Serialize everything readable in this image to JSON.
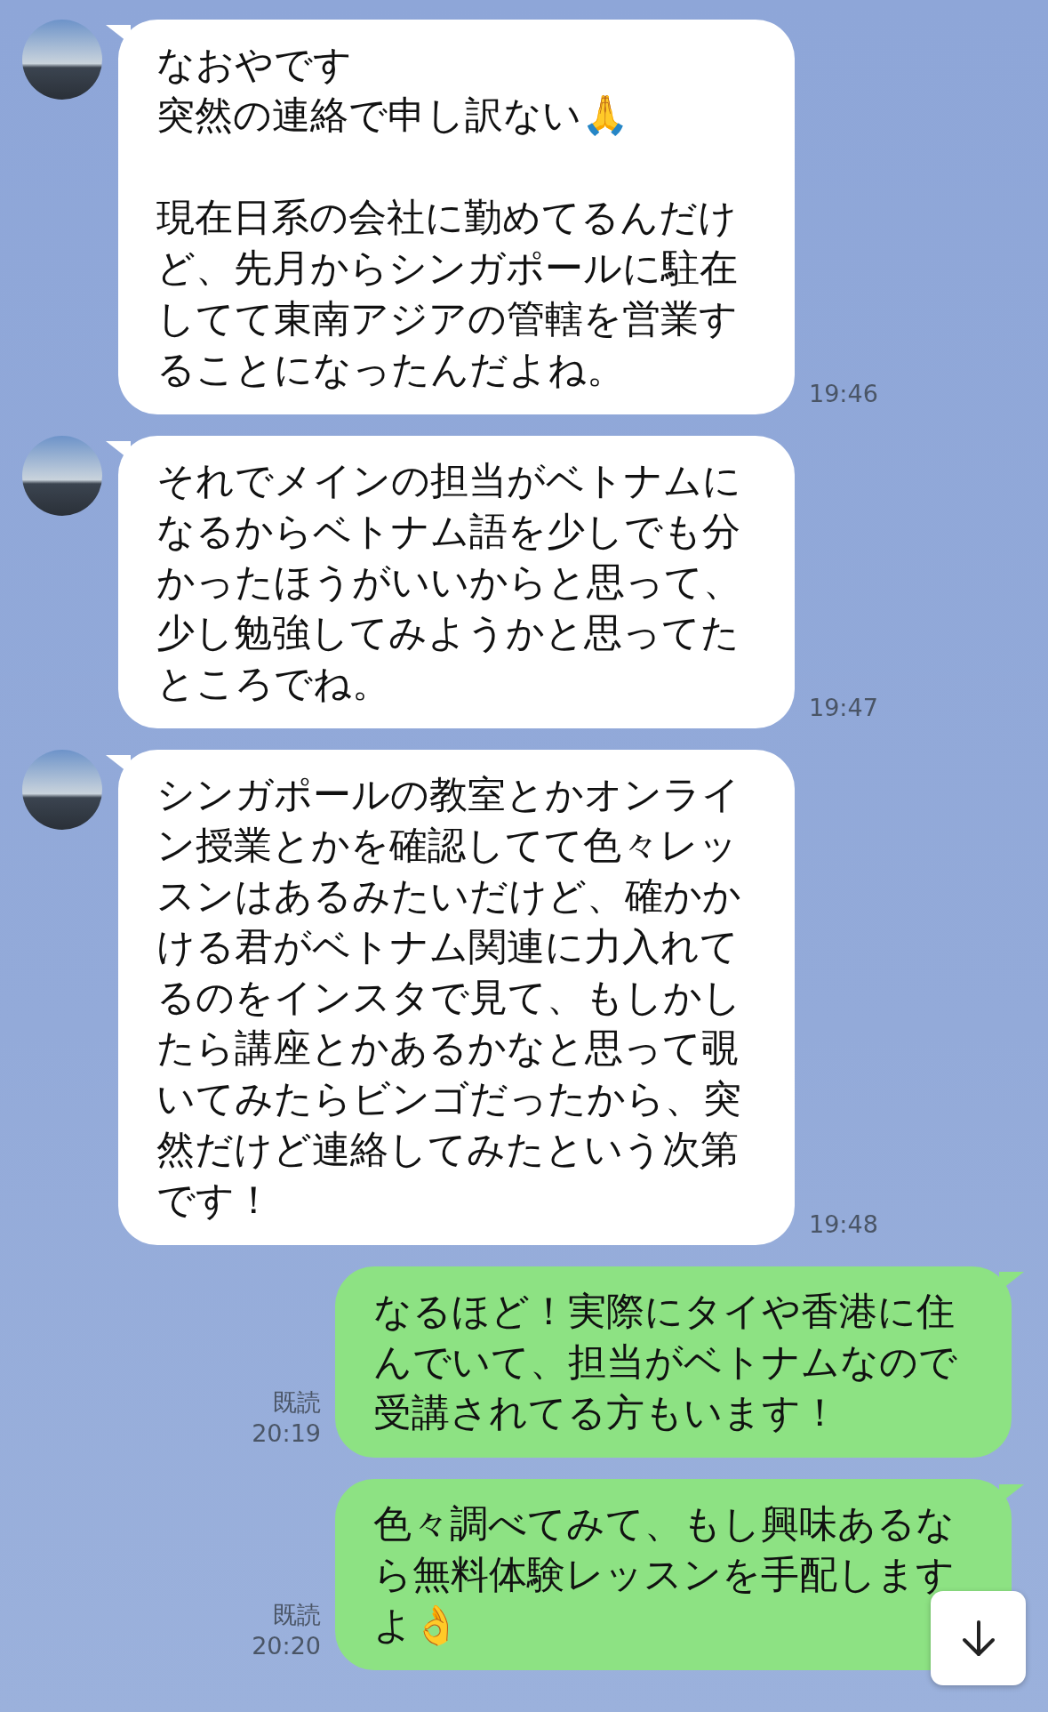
{
  "messages": [
    {
      "kind": "incoming",
      "paragraphs": [
        [
          "なおやです",
          "突然の連絡で申し訳ない🙏"
        ],
        [
          "現在日系の会社に勤めてるんだけ",
          "ど、先月からシンガポールに駐在",
          "してて東南アジアの管轄を営業す",
          "ることになったんだよね。"
        ]
      ],
      "time": "19:46"
    },
    {
      "kind": "incoming",
      "paragraphs": [
        [
          "それでメインの担当がベトナムに",
          "なるからベトナム語を少しでも分",
          "かったほうがいいからと思って、",
          "少し勉強してみようかと思ってた",
          "ところでね。"
        ]
      ],
      "time": "19:47"
    },
    {
      "kind": "incoming",
      "paragraphs": [
        [
          "シンガポールの教室とかオンライ",
          "ン授業とかを確認してて色々レッ",
          "スンはあるみたいだけど、確かか",
          "ける君がベトナム関連に力入れて",
          "るのをインスタで見て、もしかし",
          "たら講座とかあるかなと思って覗",
          "いてみたらビンゴだったから、突",
          "然だけど連絡してみたという次第",
          "です！"
        ]
      ],
      "time": "19:48"
    },
    {
      "kind": "outgoing",
      "paragraphs": [
        [
          "なるほど！実際にタイや香港に住",
          "んでいて、担当がベトナムなので",
          "受講されてる方もいます！"
        ]
      ],
      "read": "既読",
      "time": "20:19"
    },
    {
      "kind": "outgoing",
      "paragraphs": [
        [
          "色々調べてみて、もし興味あるな",
          "ら無料体験レッスンを手配します",
          "よ👌"
        ]
      ],
      "read": "既読",
      "time": "20:20"
    }
  ]
}
